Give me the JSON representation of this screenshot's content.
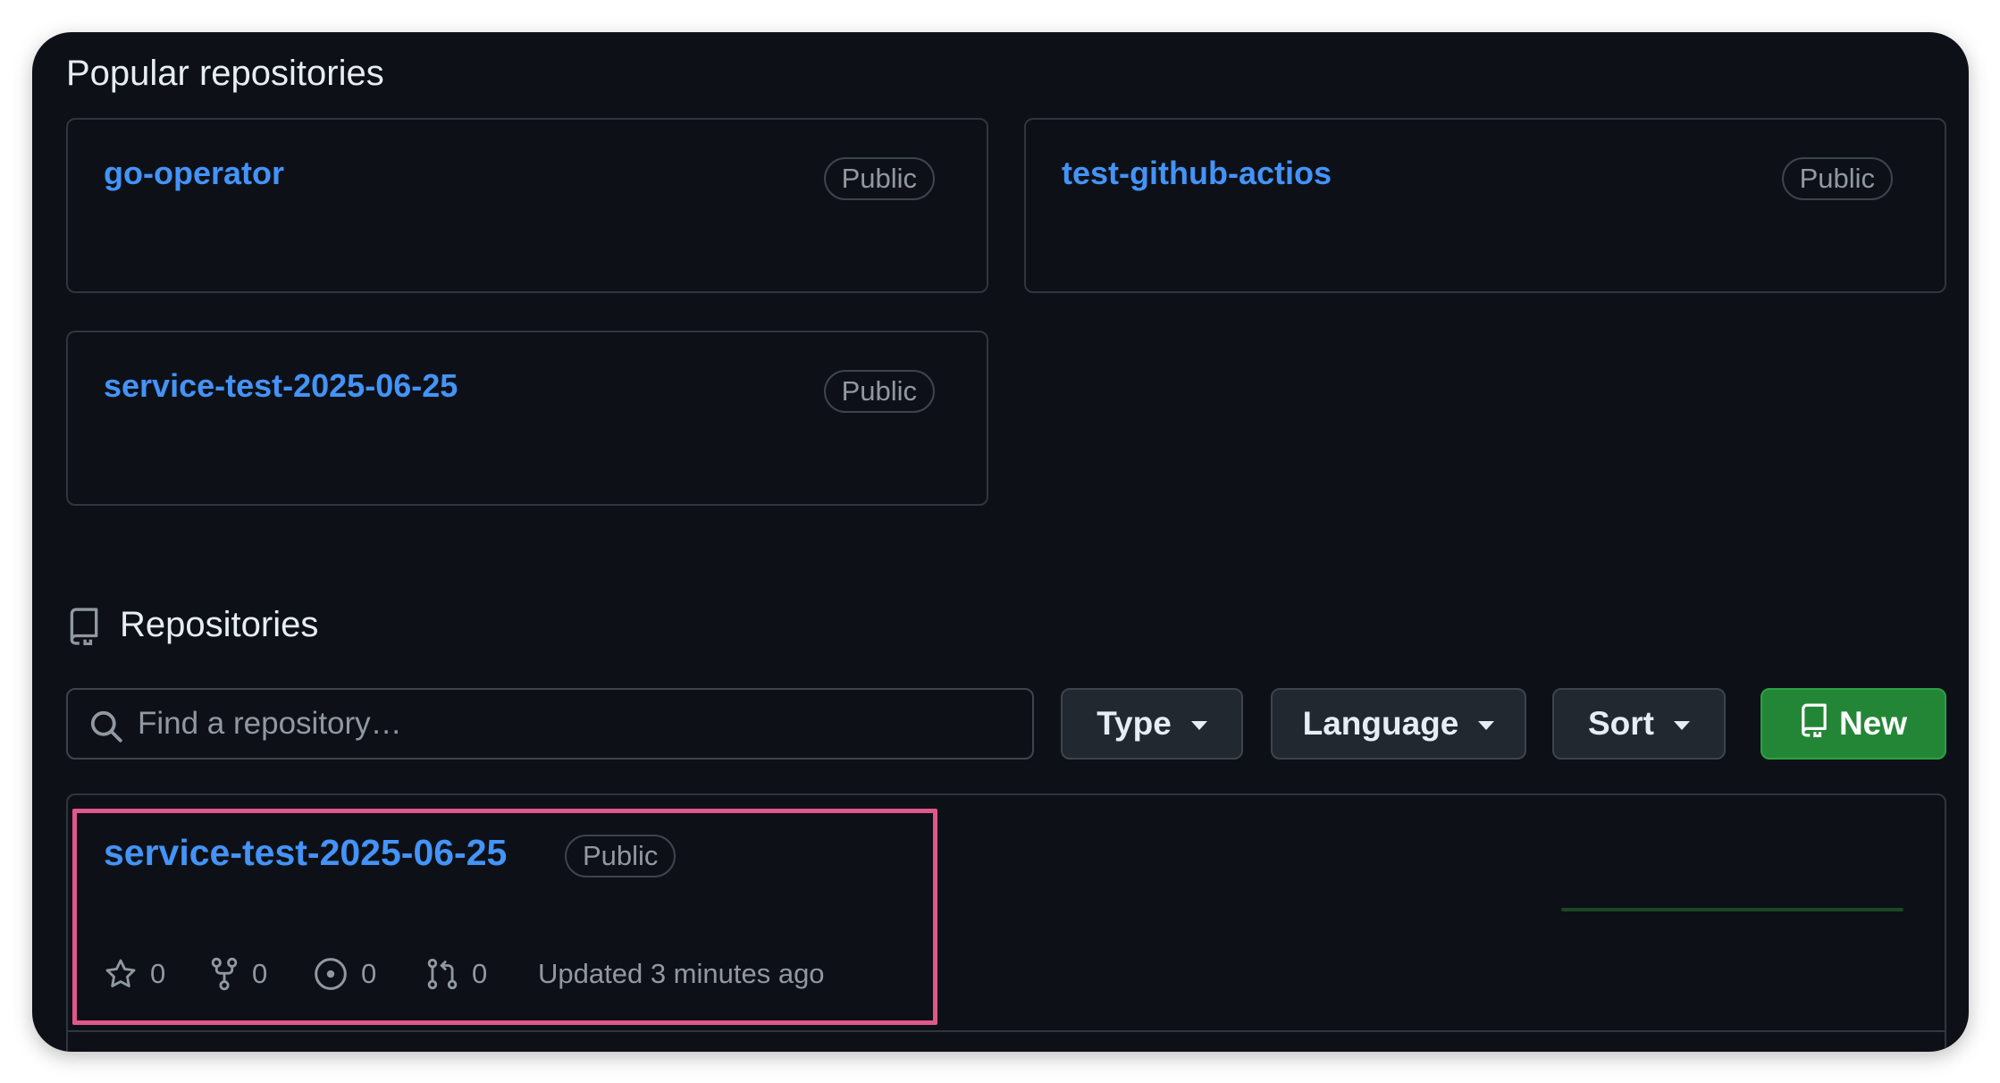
{
  "popular": {
    "title": "Popular repositories",
    "cards": [
      {
        "name": "go-operator",
        "visibility": "Public"
      },
      {
        "name": "test-github-actios",
        "visibility": "Public"
      },
      {
        "name": "service-test-2025-06-25",
        "visibility": "Public"
      }
    ]
  },
  "repositories": {
    "title": "Repositories",
    "search_placeholder": "Find a repository…",
    "filters": {
      "type": "Type",
      "language": "Language",
      "sort": "Sort"
    },
    "new_button": "New",
    "items": [
      {
        "name": "service-test-2025-06-25",
        "visibility": "Public",
        "stars": "0",
        "forks": "0",
        "issues": "0",
        "pull_requests": "0",
        "updated": "Updated 3 minutes ago"
      }
    ]
  },
  "colors": {
    "background": "#0d1117",
    "link": "#4493f8",
    "border": "#30363d",
    "new_button": "#238636",
    "highlight": "#e0588a"
  }
}
